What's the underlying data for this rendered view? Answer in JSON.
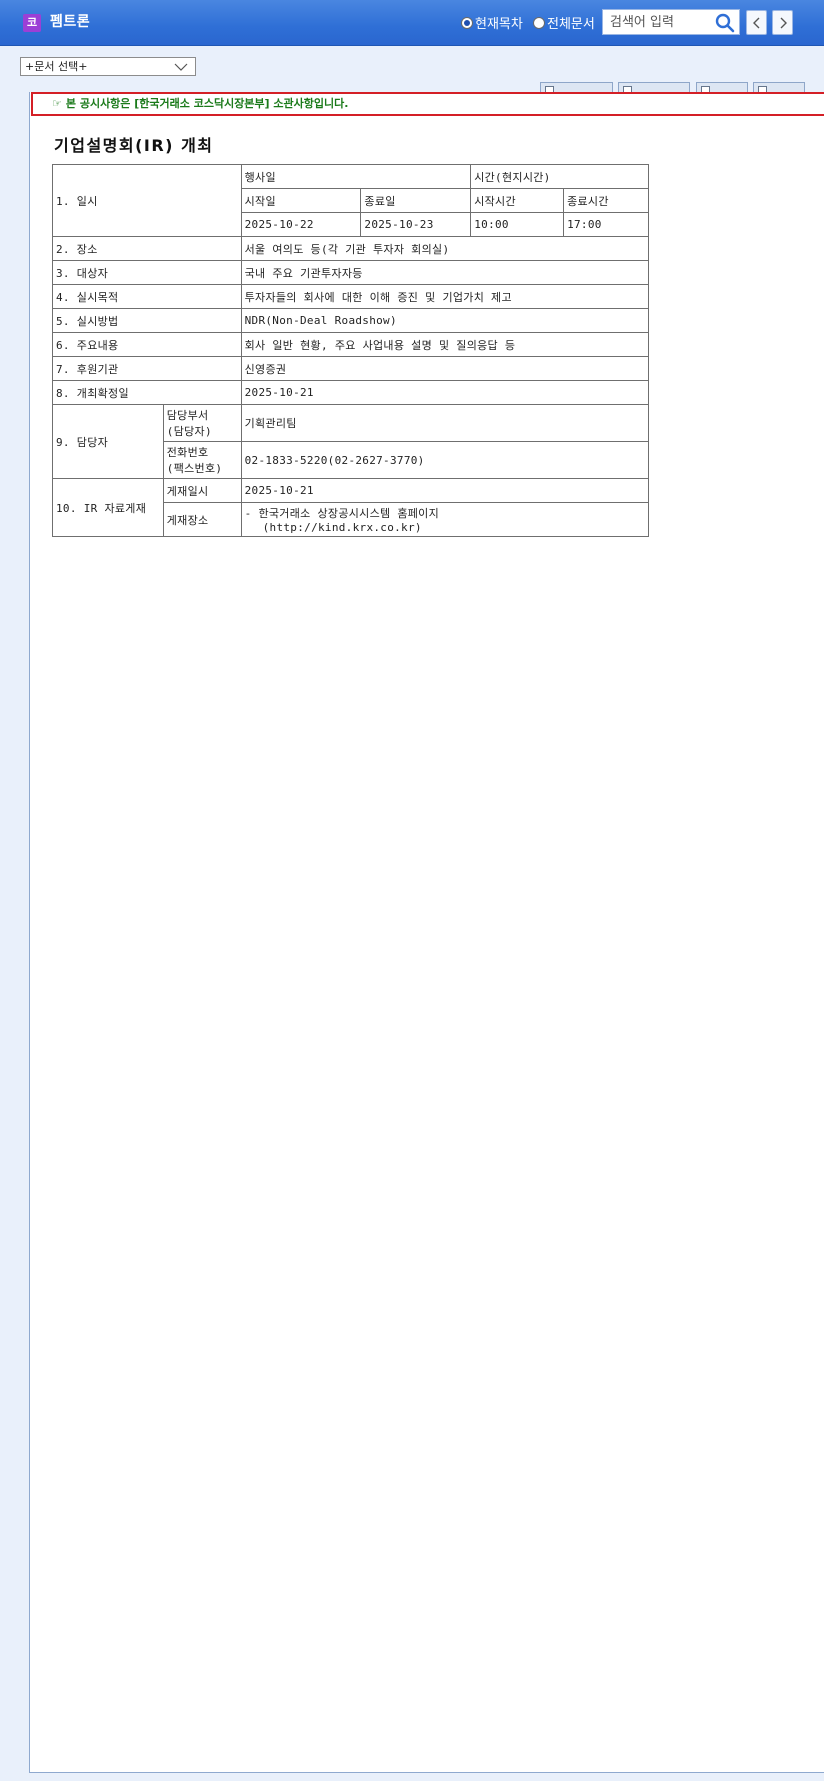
{
  "header": {
    "corp_badge": "코",
    "corp_name": "펨트론",
    "radio_current": "현재목차",
    "radio_all": "전체문서",
    "search_placeholder": "검색어 입력"
  },
  "doc_select": {
    "value": "+문서 선택+"
  },
  "notice": {
    "icon": "☞",
    "text": "본 공시사항은 [한국거래소 코스닥시장본부] 소관사항입니다."
  },
  "document": {
    "title": "기업설명회(IR) 개최",
    "rows": {
      "r1_label": "1. 일시",
      "event_date": "행사일",
      "time_local": "시간(현지시간)",
      "start_date_label": "시작일",
      "end_date_label": "종료일",
      "start_time_label": "시작시간",
      "end_time_label": "종료시간",
      "start_date": "2025-10-22",
      "end_date": "2025-10-23",
      "start_time": "10:00",
      "end_time": "17:00",
      "r2_label": "2. 장소",
      "r2_value": "서울 여의도 등(각 기관 투자자 회의실)",
      "r3_label": "3. 대상자",
      "r3_value": "국내 주요 기관투자자등",
      "r4_label": "4. 실시목적",
      "r4_value": "투자자들의 회사에 대한 이해 증진 및 기업가치 제고",
      "r5_label": "5. 실시방법",
      "r5_value": "NDR(Non-Deal Roadshow)",
      "r6_label": "6. 주요내용",
      "r6_value": "회사 일반 현황, 주요 사업내용 설명 및 질의응답 등",
      "r7_label": "7. 후원기관",
      "r7_value": "신영증권",
      "r8_label": "8. 개최확정일",
      "r8_value": "2025-10-21",
      "r9_label": "9. 담당자",
      "r9_dept_label_1": "담당부서",
      "r9_dept_label_2": "(담당자)",
      "r9_dept_value": "기획관리팀",
      "r9_phone_label_1": "전화번호",
      "r9_phone_label_2": "(팩스번호)",
      "r9_phone_value": "02-1833-5220(02-2627-3770)",
      "r10_label": "10. IR 자료게재",
      "r10_date_label": "게재일시",
      "r10_date_value": "2025-10-21",
      "r10_place_label": "게재장소",
      "r10_place_line1": "- 한국거래소 상장공시시스템 홈페이지",
      "r10_place_line2": "(http://kind.krx.co.kr)"
    }
  }
}
